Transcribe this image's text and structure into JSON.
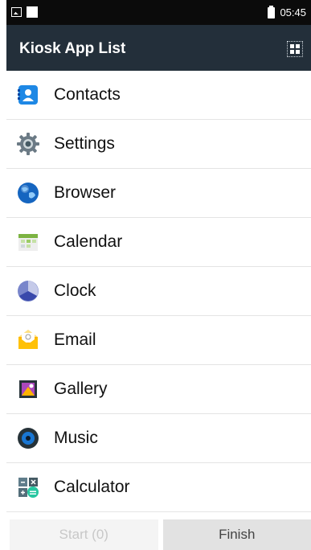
{
  "status_bar": {
    "time": "05:45",
    "icons": [
      "image-icon",
      "square-icon",
      "battery-icon"
    ]
  },
  "toolbar": {
    "title": "Kiosk App List",
    "action_icon": "grid-icon"
  },
  "apps": [
    {
      "label": "Contacts",
      "icon": "contacts-icon"
    },
    {
      "label": "Settings",
      "icon": "gear-icon"
    },
    {
      "label": "Browser",
      "icon": "globe-icon"
    },
    {
      "label": "Calendar",
      "icon": "calendar-icon"
    },
    {
      "label": "Clock",
      "icon": "clock-icon"
    },
    {
      "label": "Email",
      "icon": "email-icon"
    },
    {
      "label": "Gallery",
      "icon": "gallery-icon"
    },
    {
      "label": "Music",
      "icon": "music-icon"
    },
    {
      "label": "Calculator",
      "icon": "calculator-icon"
    }
  ],
  "buttons": {
    "start": "Start (0)",
    "finish": "Finish"
  },
  "colors": {
    "toolbar_bg": "#232f3a",
    "status_bg": "#0b0b0b"
  }
}
